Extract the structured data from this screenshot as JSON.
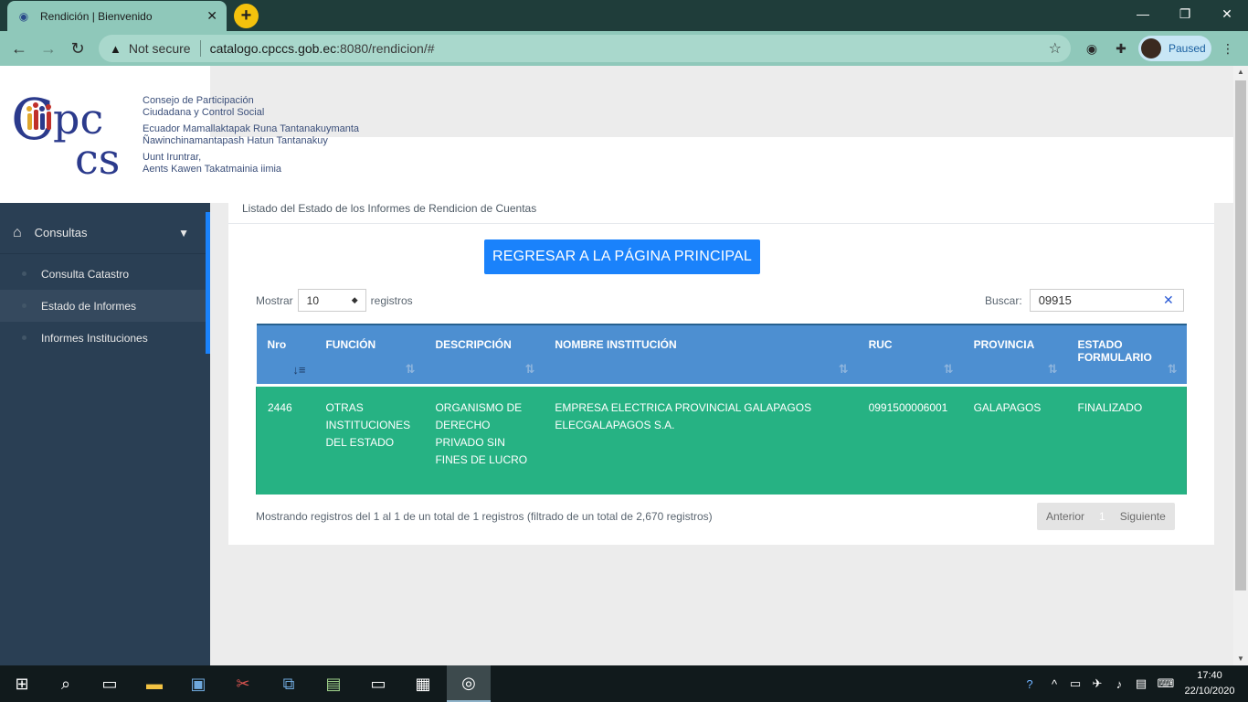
{
  "browser": {
    "tab_title": "Rendición | Bienvenido",
    "new_tab": "+",
    "security": "Not secure",
    "url_host": "catalogo.cpccs.gob.ec",
    "url_path": ":8080/rendicion/#",
    "profile_status": "Paused"
  },
  "logo": {
    "lines": [
      "Consejo de Participación",
      "Ciudadana y Control Social",
      "Ecuador Mamallaktapak Runa Tantanakuymanta",
      "Ñawinchinamantapash Hatun Tantanakuy",
      "Uunt Iruntrar,",
      "Aents Kawen Takatmainia iimia"
    ]
  },
  "sidebar": {
    "section_label": "Consultas",
    "items": [
      {
        "label": "Consulta Catastro"
      },
      {
        "label": "Estado de Informes"
      },
      {
        "label": "Informes Instituciones"
      }
    ]
  },
  "main": {
    "title": "Listado del Estado de los Informes de Rendicion de Cuentas",
    "back_button": "REGRESAR A LA PÁGINA PRINCIPAL",
    "show_label": "Mostrar",
    "show_value": "10",
    "records_label": "registros",
    "search_label": "Buscar:",
    "search_value": "09915",
    "table": {
      "headers": [
        "Nro",
        "FUNCIÓN",
        "DESCRIPCIÓN",
        "NOMBRE INSTITUCIÓN",
        "RUC",
        "PROVINCIA",
        "ESTADO FORMULARIO"
      ],
      "rows": [
        [
          "2446",
          "OTRAS INSTITUCIONES DEL ESTADO",
          "ORGANISMO DE DERECHO PRIVADO SIN FINES DE LUCRO",
          "EMPRESA ELECTRICA PROVINCIAL GALAPAGOS ELECGALAPAGOS S.A.",
          "0991500006001",
          "GALAPAGOS",
          "FINALIZADO"
        ]
      ]
    },
    "info": "Mostrando registros del 1 al 1 de un total de 1 registros (filtrado de un total de 2,670 registros)",
    "pager": {
      "prev": "Anterior",
      "current": "1",
      "next": "Siguiente"
    }
  },
  "taskbar": {
    "time": "17:40",
    "date": "22/10/2020"
  },
  "colors": {
    "sidebar_bg": "#2a3f54",
    "accent_blue": "#1a82fb",
    "table_header": "#4d8fd1",
    "row_highlight": "#26b283"
  }
}
